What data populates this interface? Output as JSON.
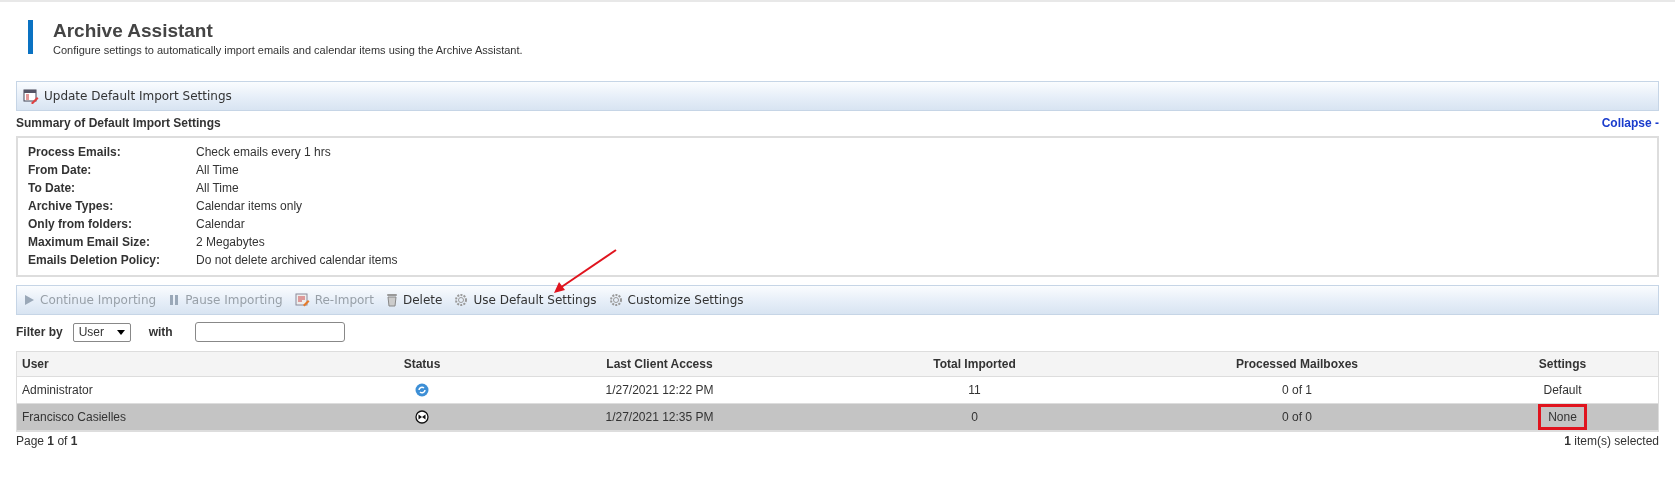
{
  "header": {
    "title": "Archive Assistant",
    "subtitle": "Configure settings to automatically import emails and calendar items using the Archive Assistant."
  },
  "top_toolbar": {
    "button": "Update Default Import Settings"
  },
  "summary": {
    "title": "Summary of Default Import Settings",
    "collapse_link": "Collapse -",
    "rows": [
      {
        "label": "Process Emails:",
        "value": "Check emails every 1 hrs"
      },
      {
        "label": "From Date:",
        "value": "All Time"
      },
      {
        "label": "To Date:",
        "value": "All Time"
      },
      {
        "label": "Archive Types:",
        "value": "Calendar items only"
      },
      {
        "label": "Only from folders:",
        "value": "Calendar"
      },
      {
        "label": "Maximum Email Size:",
        "value": "2 Megabytes"
      },
      {
        "label": "Emails Deletion Policy:",
        "value": "Do not delete archived calendar items"
      }
    ]
  },
  "actions": [
    {
      "kind": "play",
      "label": "Continue Importing",
      "disabled": true
    },
    {
      "kind": "pause",
      "label": "Pause Importing",
      "disabled": true
    },
    {
      "kind": "edit",
      "label": "Re-Import",
      "disabled": true
    },
    {
      "kind": "trash",
      "label": "Delete",
      "disabled": false
    },
    {
      "kind": "gear",
      "label": "Use Default Settings",
      "disabled": false,
      "annotated": true
    },
    {
      "kind": "gear",
      "label": "Customize Settings",
      "disabled": false
    }
  ],
  "filter": {
    "label": "Filter by",
    "select_value": "User",
    "with_label": "with"
  },
  "table": {
    "columns": [
      "User",
      "Status",
      "Last Client Access",
      "Total Imported",
      "Processed Mailboxes",
      "Settings"
    ],
    "rows": [
      {
        "user": "Administrator",
        "kind": "sync",
        "last_access": "1/27/2021 12:22 PM",
        "total": "11",
        "processed": "0 of 1",
        "settings": "Default",
        "selected": false,
        "highlighted": false
      },
      {
        "user": "Francisco Casielles",
        "kind": "stopped",
        "last_access": "1/27/2021 12:35 PM",
        "total": "0",
        "processed": "0 of 0",
        "settings": "None",
        "selected": true,
        "highlighted": true
      }
    ]
  },
  "footer": {
    "page": "Page **1** of **1**",
    "selection": "**1** item(s) selected"
  }
}
